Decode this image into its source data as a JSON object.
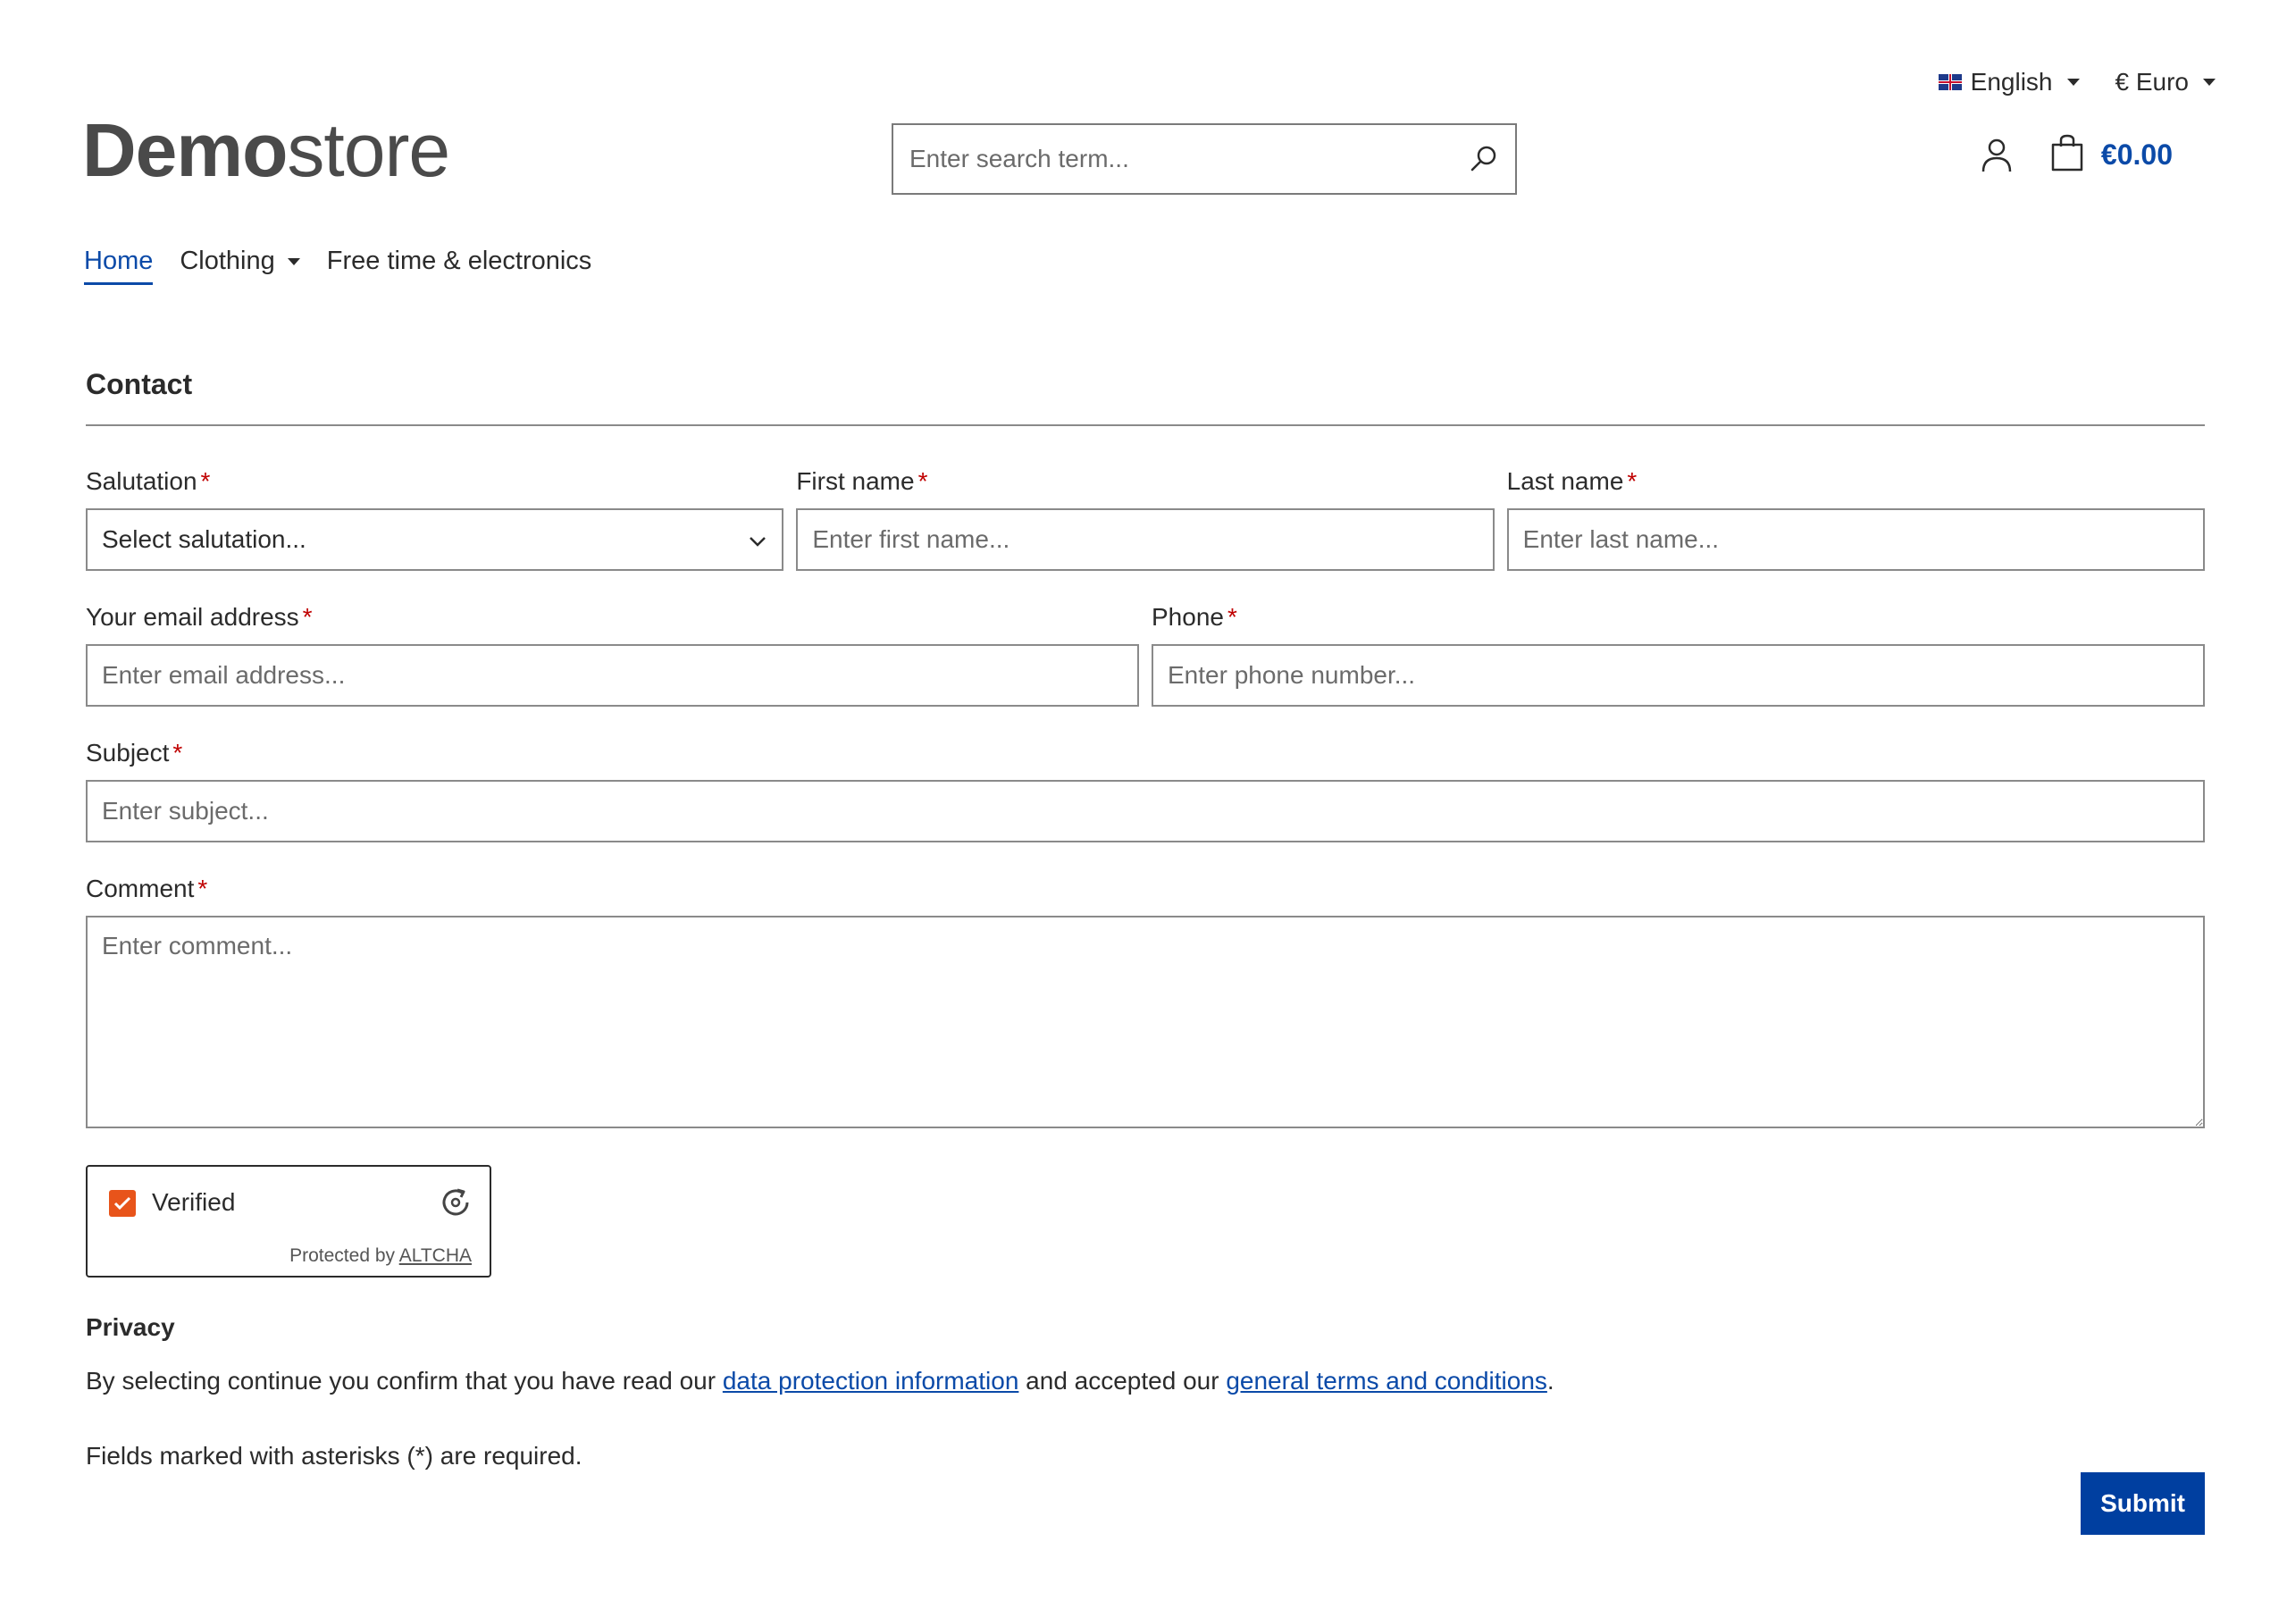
{
  "topbar": {
    "language": "English",
    "currency": "€ Euro"
  },
  "header": {
    "logo_bold": "Demo",
    "logo_light": "store",
    "search_placeholder": "Enter search term...",
    "cart_total": "€0.00"
  },
  "nav": {
    "items": [
      {
        "label": "Home",
        "active": true
      },
      {
        "label": "Clothing",
        "dropdown": true
      },
      {
        "label": "Free time & electronics"
      }
    ]
  },
  "form": {
    "title": "Contact",
    "required_marker": "*",
    "salutation": {
      "label": "Salutation",
      "value": "Select salutation..."
    },
    "first_name": {
      "label": "First name",
      "placeholder": "Enter first name..."
    },
    "last_name": {
      "label": "Last name",
      "placeholder": "Enter last name..."
    },
    "email": {
      "label": "Your email address",
      "placeholder": "Enter email address..."
    },
    "phone": {
      "label": "Phone",
      "placeholder": "Enter phone number..."
    },
    "subject": {
      "label": "Subject",
      "placeholder": "Enter subject..."
    },
    "comment": {
      "label": "Comment",
      "placeholder": "Enter comment..."
    },
    "captcha": {
      "status": "Verified",
      "protected_by": "Protected by",
      "provider": "ALTCHA",
      "checked": true
    },
    "privacy": {
      "title": "Privacy",
      "text_before": "By selecting continue you confirm that you have read our ",
      "link1": "data protection information",
      "text_middle": " and accepted our ",
      "link2": "general terms and conditions",
      "text_after": "."
    },
    "required_note": "Fields marked with asterisks (*) are required.",
    "submit_label": "Submit"
  },
  "colors": {
    "accent": "#0b4aa8",
    "submit_bg": "#003fa0",
    "required": "#c00000",
    "captcha_check": "#e8541a"
  },
  "icons": [
    "flag-uk-icon",
    "search-icon",
    "user-icon",
    "cart-icon",
    "chevron-down-icon",
    "checkmark-icon",
    "refresh-icon"
  ]
}
